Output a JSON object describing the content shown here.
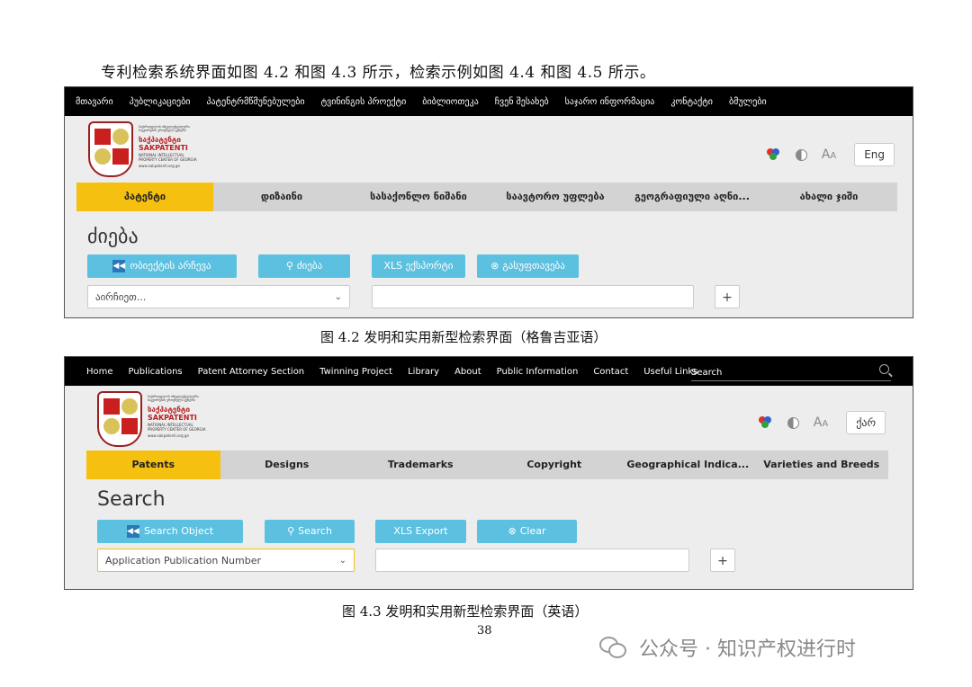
{
  "intro_text": "专利检索系统界面如图 4.2 和图 4.3 所示，检索示例如图 4.4 和图 4.5 所示。",
  "figure1": {
    "nav": [
      "მთავარი",
      "პუბლიკაციები",
      "პატენტრმწმუნებულები",
      "ტვინინგის პროექტი",
      "ბიბლიოთეკა",
      "ჩვენ შესახებ",
      "საჯარო ინფორმაცია",
      "კონტაქტი",
      "ბმულები"
    ],
    "logo": {
      "small_text": "საქართველოს ინტელექტუალური საკუთრების ეროვნული ცენტრი",
      "brand_ka": "საქპატენტი",
      "brand_en": "SAKPATENTI",
      "national": "NATIONAL INTELLECTUAL PROPERTY CENTER OF GEORGIA",
      "url": "www.sakpatenti.org.ge"
    },
    "search_label": "",
    "lang_button": "Eng",
    "tabs": [
      "პატენტი",
      "დიზაინი",
      "სასაქონლო ნიშანი",
      "საავტორო უფლება",
      "გეოგრაფიული აღნი...",
      "ახალი ჯიში"
    ],
    "heading": "ძიება",
    "buttons": {
      "search_object": "ობიექტის არჩევა",
      "search": "ძიება",
      "xls_export": "XLS ექსპორტი",
      "clear": "გასუფთავება"
    },
    "select_value": "აირჩიეთ...",
    "plus": "+"
  },
  "caption1": "图 4.2  发明和实用新型检索界面（格鲁吉亚语）",
  "figure2": {
    "nav": [
      "Home",
      "Publications",
      "Patent Attorney Section",
      "Twinning Project",
      "Library",
      "About",
      "Public Information",
      "Contact",
      "Useful Links"
    ],
    "search_label": "Search",
    "logo": {
      "small_text": "საქართველოს ინტელექტუალური საკუთრების ეროვნული ცენტრი",
      "brand_ka": "საქპატენტი",
      "brand_en": "SAKPATENTI",
      "national": "NATIONAL INTELLECTUAL PROPERTY CENTER OF GEORGIA",
      "url": "www.sakpatenti.org.ge"
    },
    "lang_button": "ქარ",
    "tabs": [
      "Patents",
      "Designs",
      "Trademarks",
      "Copyright",
      "Geographical Indica...",
      "Varieties and Breeds"
    ],
    "heading": "Search",
    "buttons": {
      "search_object": "Search Object",
      "search": "Search",
      "xls_export": "XLS Export",
      "clear": "Clear"
    },
    "select_value": "Application Publication Number",
    "plus": "+"
  },
  "caption2": "图 4.3  发明和实用新型检索界面（英语）",
  "page_number": "38",
  "watermark": "公众号 · 知识产权进行时"
}
